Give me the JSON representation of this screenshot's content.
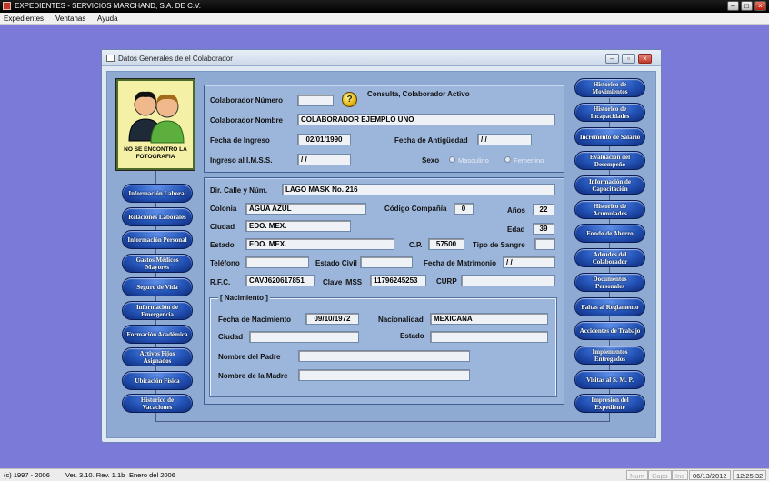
{
  "app": {
    "title": "EXPEDIENTES - SERVICIOS MARCHAND, S.A. DE C.V."
  },
  "menu": [
    "Expedientes",
    "Ventanas",
    "Ayuda"
  ],
  "window": {
    "title": "Datos Generales de el Colaborador"
  },
  "photo": {
    "caption_line1": "NO SE ENCONTRO LA",
    "caption_line2": "FOTOGRAFIA"
  },
  "left_buttons": [
    "Información Laboral",
    "Relaciones Laborales",
    "Información Personal",
    "Gastos Médicos Mayores",
    "Seguro de Vida",
    "Información de Emergencia",
    "Formación Académica",
    "Activos Fijos Asignados",
    "Ubicación Física",
    "Historico de Vacaciones"
  ],
  "right_buttons": [
    "Historico de Movimientos",
    "Historico de Incapacidades",
    "Incremento de Salario",
    "Evaluación del Desempeño",
    "Información de Capacitación",
    "Historico de Acumulados",
    "Fondo de Ahorro",
    "Adeudos del Colaborador",
    "Documentos Personales",
    "Faltas al Reglamento",
    "Accidentes de Trabajo",
    "Implementos Entregados",
    "Visitas al S. M. P.",
    "Impresión del Expediente"
  ],
  "header": {
    "colaborador_numero_label": "Colaborador  Número",
    "colaborador_numero_value": "",
    "status_text": "Consulta, Colaborador Activo",
    "help_glyph": "?",
    "colaborador_nombre_label": "Colaborador  Nombre",
    "colaborador_nombre_value": "COLABORADOR EJEMPLO UNO",
    "fecha_ingreso_label": "Fecha de Ingreso",
    "fecha_ingreso_value": "02/01/1990",
    "fecha_antiguedad_label": "Fecha de Antigüedad",
    "fecha_antiguedad_value": "  /  /",
    "ingreso_imss_label": "Ingreso al I.M.S.S.",
    "ingreso_imss_value": "  /  /",
    "sexo_label": "Sexo",
    "sexo_masculino": "Masculino",
    "sexo_femenino": "Femenino"
  },
  "address": {
    "dir_label": "Dir. Calle y Núm.",
    "dir_value": "LAGO MASK  No. 216",
    "colonia_label": "Colonia",
    "colonia_value": "AGUA AZUL",
    "codigo_compania_label": "Código Compañía",
    "codigo_compania_value": "0",
    "anios_label": "Años",
    "anios_value": "22",
    "ciudad_label": "Ciudad",
    "ciudad_value": "EDO. MEX.",
    "edad_label": "Edad",
    "edad_value": "39",
    "estado_label": "Estado",
    "estado_value": "EDO. MEX.",
    "cp_label": "C.P.",
    "cp_value": "57500",
    "tipo_sangre_label": "Tipo de Sangre",
    "tipo_sangre_value": "",
    "telefono_label": "Teléfono",
    "telefono_value": "",
    "estado_civil_label": "Estado Civil",
    "estado_civil_value": "",
    "fecha_matrimonio_label": "Fecha de Matrimonio",
    "fecha_matrimonio_value": "  /  /",
    "rfc_label": "R.F.C.",
    "rfc_value": "CAVJ620617851",
    "clave_imss_label": "Clave IMSS",
    "clave_imss_value": "11796245253",
    "curp_label": "CURP",
    "curp_value": ""
  },
  "nacimiento": {
    "group_label": "[ Nacimiento ]",
    "fecha_label": "Fecha de Nacimiento",
    "fecha_value": "09/10/1972",
    "nacionalidad_label": "Nacionalidad",
    "nacionalidad_value": "MEXICANA",
    "ciudad_label": "Ciudad",
    "ciudad_value": "",
    "estado_label": "Estado",
    "estado_value": "",
    "padre_label": "Nombre del Padre",
    "padre_value": "",
    "madre_label": "Nombre de la Madre",
    "madre_value": ""
  },
  "status": {
    "copyright": "(c) 1997 - 2006",
    "version": "Ver. 3.10. Rev. 1.1b",
    "release": "Enero del 2006",
    "num": "Num",
    "caps": "Caps",
    "ins": "Ins",
    "date": "06/13/2012",
    "time": "12:25:32"
  },
  "colors": {
    "desktop": "#7b7ad8",
    "panel": "#9cb5da",
    "button": "#2454b8"
  }
}
